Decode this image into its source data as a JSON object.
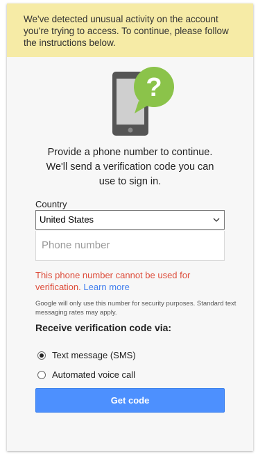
{
  "banner": {
    "text": "We've detected unusual activity on the account you're trying to access. To continue, please follow the instructions below."
  },
  "illustration": {
    "icon": "phone-question-icon",
    "bubble_glyph": "?",
    "colors": {
      "phone": "#555555",
      "screen": "#cfcfcf",
      "bubble": "#8bc34a"
    }
  },
  "prompt": {
    "line1": "Provide a phone number to continue.",
    "line2": "We'll send a verification code you can",
    "line3": "use to sign in."
  },
  "form": {
    "country_label": "Country",
    "country_value": "United States",
    "phone_placeholder": "Phone number",
    "error_text": "This phone number cannot be used for verification.",
    "learn_more": "Learn more",
    "note": "Google will only use this number for security purposes. Standard text messaging rates may apply."
  },
  "receive": {
    "label": "Receive verification code via:",
    "options": [
      {
        "label": "Text message (SMS)",
        "checked": true
      },
      {
        "label": "Automated voice call",
        "checked": false
      }
    ]
  },
  "button": {
    "label": "Get code"
  },
  "colors": {
    "accent": "#4d90fe",
    "error": "#dd4b39",
    "banner": "#f6eba6",
    "link": "#427fed"
  }
}
